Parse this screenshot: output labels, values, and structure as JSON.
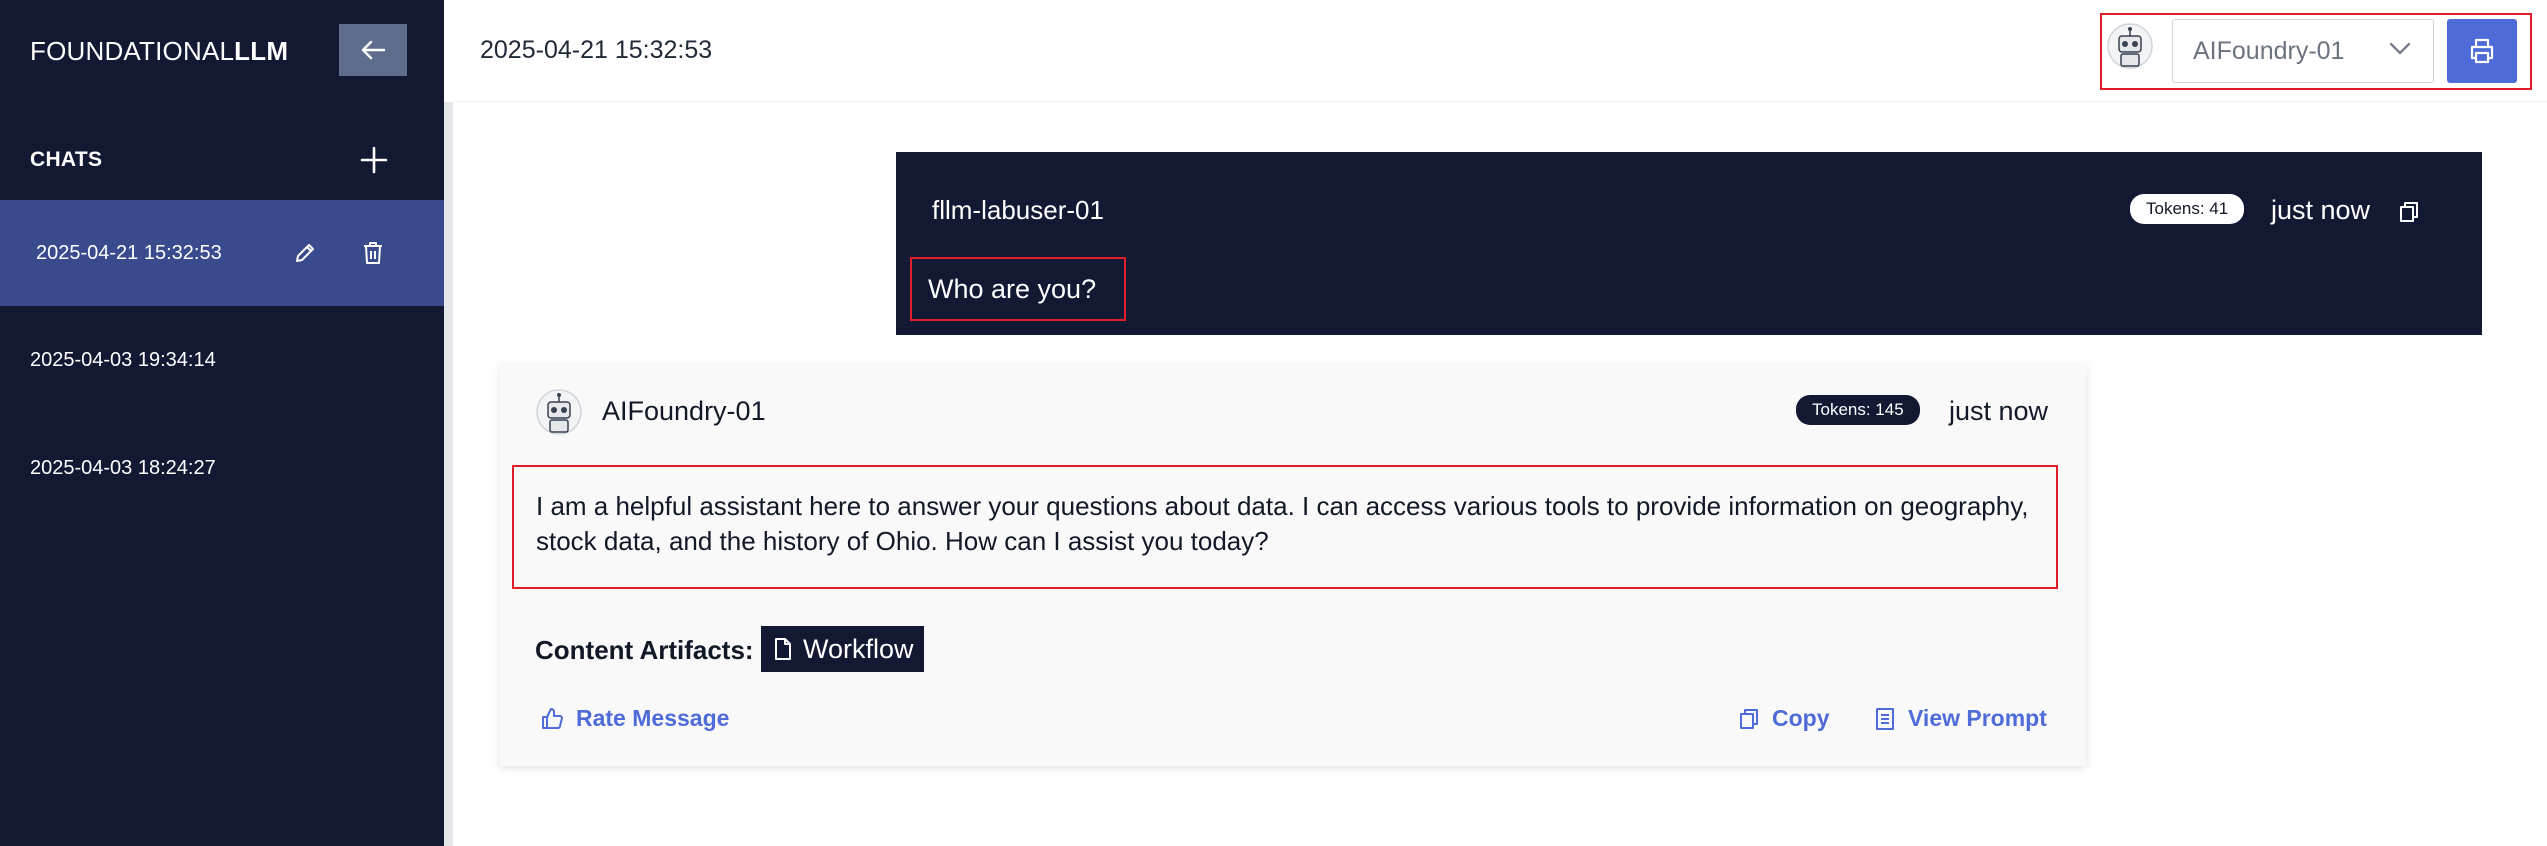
{
  "brand": {
    "light": "FOUNDATIONAL",
    "bold": "LLM"
  },
  "sidebar": {
    "chats_heading": "CHATS",
    "items": [
      {
        "label": "2025-04-21 15:32:53",
        "active": true
      },
      {
        "label": "2025-04-03 19:34:14",
        "active": false
      },
      {
        "label": "2025-04-03 18:24:27",
        "active": false
      }
    ]
  },
  "header": {
    "session_title": "2025-04-21 15:32:53",
    "agent_selected": "AIFoundry-01"
  },
  "user_message": {
    "sender": "fllm-labuser-01",
    "tokens": "Tokens: 41",
    "time": "just now",
    "text": "Who are you?"
  },
  "assistant_message": {
    "sender": "AIFoundry-01",
    "tokens": "Tokens: 145",
    "time": "just now",
    "text": "I am a helpful assistant here to answer your questions about data. I can access various tools to provide information on geography, stock data, and the history of Ohio. How can I assist you today?",
    "artifacts_label": "Content Artifacts:",
    "artifact_name": "Workflow",
    "rate_label": "Rate Message",
    "copy_label": "Copy",
    "view_prompt_label": "View Prompt"
  },
  "colors": {
    "sidebar_bg": "#131833",
    "active_chat": "#3a4b8d",
    "accent": "#4f6bd8",
    "highlight_border": "#e11d2a"
  },
  "icons": [
    "arrow-left-icon",
    "plus-icon",
    "pencil-icon",
    "trash-icon",
    "robot-avatar-icon",
    "chevron-down-icon",
    "printer-icon",
    "copy-icon",
    "file-icon",
    "thumbs-up-icon",
    "document-lines-icon"
  ]
}
